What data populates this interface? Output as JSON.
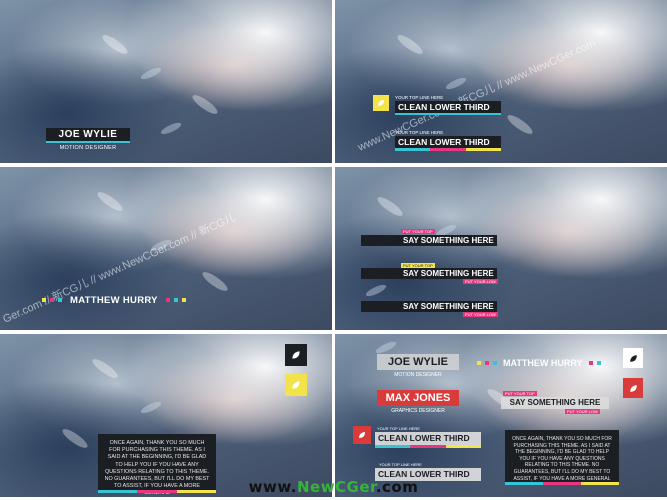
{
  "panel1": {
    "name": "JOE WYLIE",
    "role": "MOTION DESIGNER"
  },
  "panel2": {
    "top_line_1": "YOUR TOP LINE HERE",
    "title_1": "CLEAN LOWER THIRD",
    "top_line_2": "YOUR TOP LINE HERE",
    "title_2": "CLEAN LOWER THIRD"
  },
  "panel3": {
    "name": "MATTHEW HURRY"
  },
  "panel4": {
    "rows": [
      {
        "top": "PUT YOUR TOP",
        "title": "SAY SOMETHING HERE",
        "low": ""
      },
      {
        "top": "PUT YOUR TOP",
        "title": "SAY SOMETHING HERE",
        "low": "PUT YOUR LOW"
      },
      {
        "top": "",
        "title": "SAY SOMETHING HERE",
        "low": "PUT YOUR LOW"
      }
    ]
  },
  "panel5": {
    "message": "ONCE AGAIN, THANK YOU SO MUCH FOR PURCHASING THIS THEME. AS I SAID AT THE BEGINNING, I'D BE GLAD TO HELP YOU IF YOU HAVE ANY QUESTIONS RELATING TO THIS THEME. NO GUARANTEES, BUT I'LL DO MY BEST TO ASSIST, IF YOU HAVE A MORE GENERAL"
  },
  "panel6": {
    "name_1": "JOE WYLIE",
    "role_1": "MOTION DESIGNER",
    "name_2": "MAX JONES",
    "role_2": "GRAPHICS DESIGNER",
    "name_3": "MATTHEW HURRY",
    "top_1": "PUT YOUR TOP",
    "say": "SAY SOMETHING HERE",
    "low_1": "PUT YOUR LOW",
    "top_line_1": "YOUR TOP LINE HERE",
    "clean_1": "CLEAN LOWER THIRD",
    "top_line_2": "YOUR TOP LINE HERE",
    "clean_2": "CLEAN LOWER THIRD",
    "message": "ONCE AGAIN, THANK YOU SO MUCH FOR PURCHASING THIS THEME. AS I SAID AT THE BEGINNING, I'D BE GLAD TO HELP YOU IF YOU HAVE ANY QUESTIONS RELATING TO THIS THEME. NO GUARANTEES, BUT I'LL DO MY BEST TO ASSIST, IF YOU HAVE A MORE GENERAL"
  },
  "watermarks": {
    "text_1": "www.NewCGer.com // 新CG儿 // www.NewCGer.com",
    "text_2": "Ger.com // 新CG儿 // www.NewCGer.com // 新CG儿",
    "text_3": "www.NewCGer.com // 新CG儿 // www.NewCGer.com"
  },
  "footer": {
    "left": "www.",
    "mid": "NewCGer",
    "right": ".com"
  },
  "colors": {
    "accent_pink": "#e7387d",
    "accent_cyan": "#37c5d4",
    "accent_yellow": "#f3e34a",
    "logo_red": "#d93a3a",
    "dark_bar": "#1b1e23"
  },
  "icons": {
    "logo": "leaf-drop-icon"
  }
}
